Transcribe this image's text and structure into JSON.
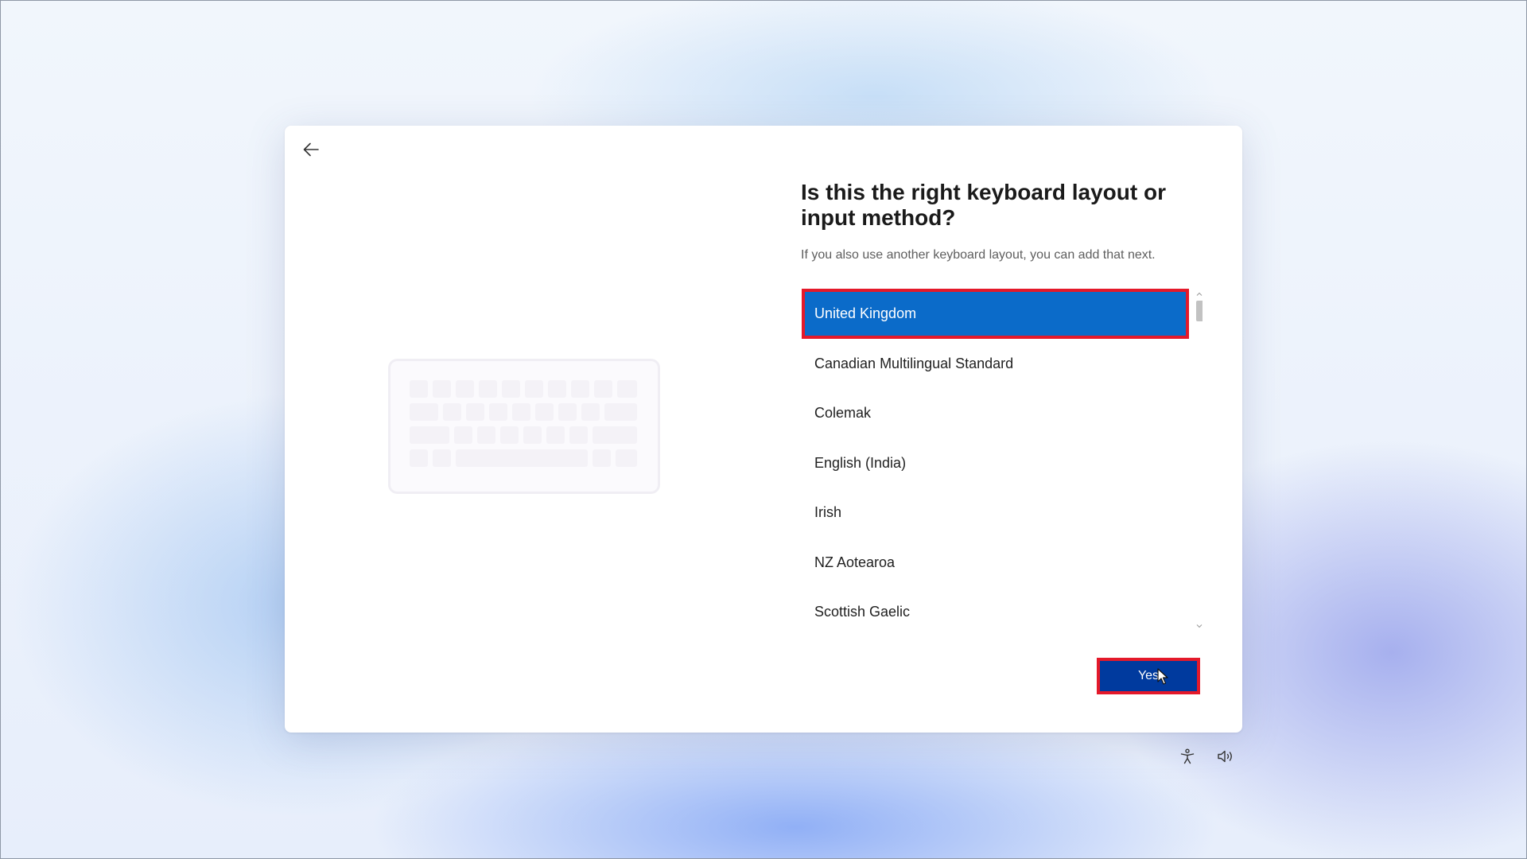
{
  "dialog": {
    "heading": "Is this the right keyboard layout or input method?",
    "subtext": "If you also use another keyboard layout, you can add that next.",
    "back_icon": "arrow-left-icon",
    "illustration": "keyboard-illustration"
  },
  "layout_list": {
    "selected_index": 0,
    "items": [
      {
        "label": "United Kingdom",
        "selected": true
      },
      {
        "label": "Canadian Multilingual Standard",
        "selected": false
      },
      {
        "label": "Colemak",
        "selected": false
      },
      {
        "label": "English (India)",
        "selected": false
      },
      {
        "label": "Irish",
        "selected": false
      },
      {
        "label": "NZ Aotearoa",
        "selected": false
      },
      {
        "label": "Scottish Gaelic",
        "selected": false
      }
    ]
  },
  "actions": {
    "yes_label": "Yes"
  },
  "footer": {
    "accessibility_icon": "accessibility-icon",
    "volume_icon": "volume-icon"
  },
  "colors": {
    "selected_row": "#0b6bc9",
    "primary_button": "#003a9e",
    "highlight_outline": "#e4192a"
  }
}
